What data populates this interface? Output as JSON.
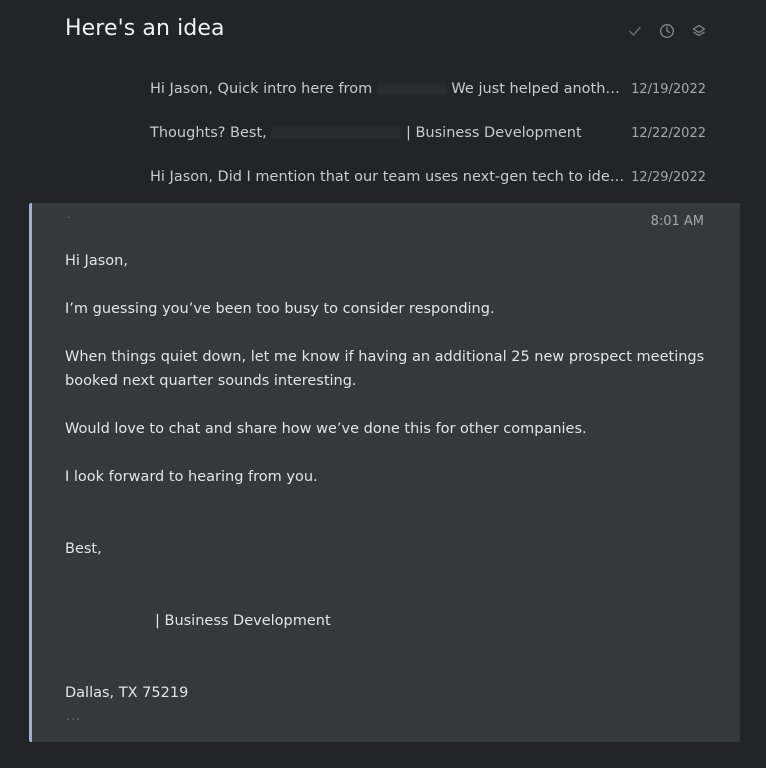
{
  "subject": "Here's an idea",
  "header_icons": [
    "check-icon",
    "clock-icon",
    "layers-icon"
  ],
  "thread": [
    {
      "snippet": "Hi Jason, Quick intro here from",
      "snippet_cont": "We just helped another com…",
      "date": "12/19/2022"
    },
    {
      "snippet": "Thoughts? Best,",
      "snippet_cont": "| Business Development",
      "date": "12/22/2022"
    },
    {
      "snippet": "Hi Jason, Did I mention that our team uses next-gen tech to identify an…",
      "snippet_cont": "",
      "date": "12/29/2022"
    }
  ],
  "message": {
    "sender": "·",
    "time": "8:01 AM",
    "greeting": "Hi Jason,",
    "p1": "I’m guessing you’ve been too busy to consider responding.",
    "p2": "When things quiet down, let me know if having an additional 25 new prospect meetings booked next quarter sounds interesting.",
    "p3": "Would love to chat and share how we’ve done this for other companies.",
    "p4": "I look forward to hearing from you.",
    "closing": "Best,",
    "signature_title": "| Business Development",
    "address": "Dallas, TX 75219",
    "more": "···"
  },
  "colors": {
    "background": "#232427",
    "message_bg": "#35383c",
    "accent_border": "#a4acd1"
  }
}
